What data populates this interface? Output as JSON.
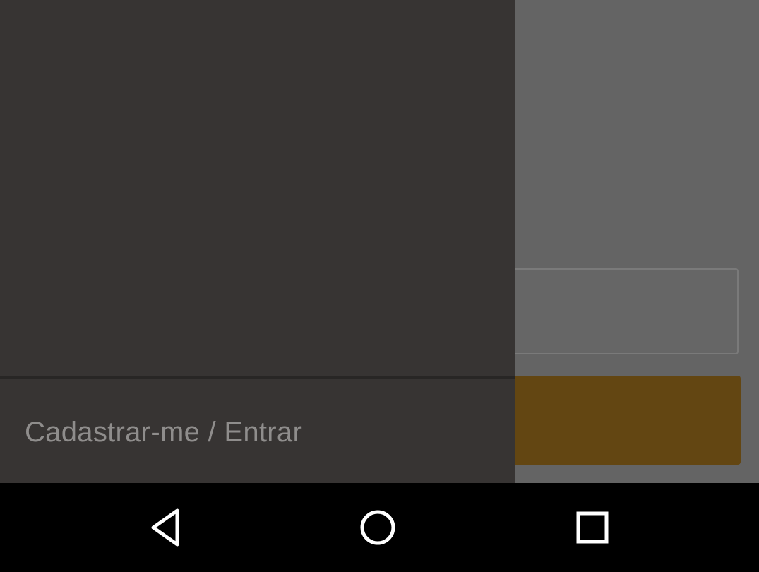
{
  "drawer": {
    "login_item_label": "Cadastrar-me / Entrar"
  },
  "navbar": {
    "back_icon": "back-triangle-icon",
    "home_icon": "home-circle-icon",
    "recents_icon": "recents-square-icon"
  },
  "colors": {
    "drawer_background": "#373433",
    "scrim": "#646464",
    "accent_button_dimmed": "#634612",
    "navbar": "#000000"
  }
}
